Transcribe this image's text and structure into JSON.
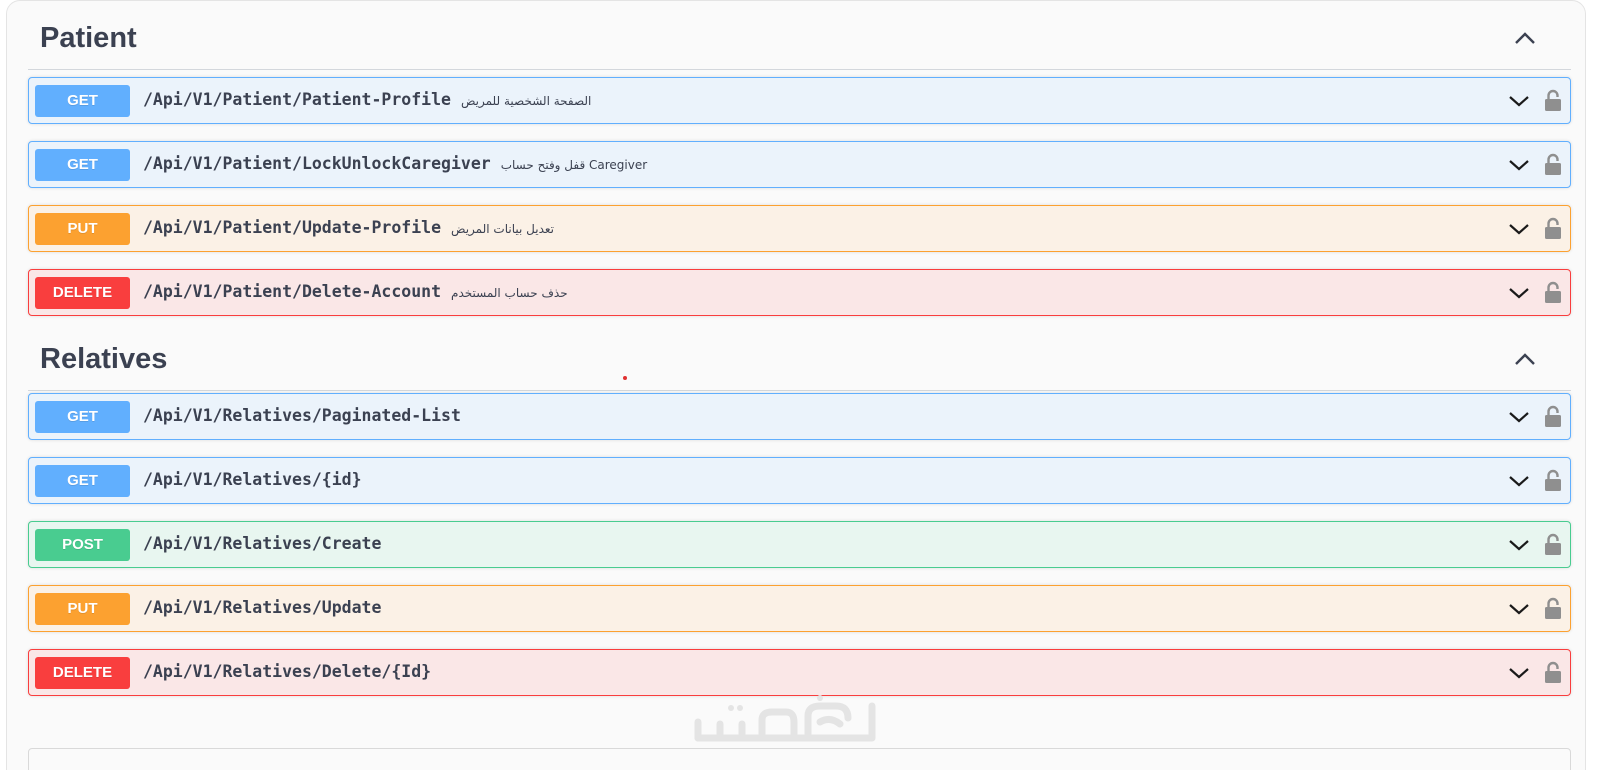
{
  "sections": [
    {
      "title": "Patient",
      "operations": [
        {
          "method": "GET",
          "path": "/Api/V1/Patient/Patient-Profile",
          "description": "الصفحة الشخصية للمريض"
        },
        {
          "method": "GET",
          "path": "/Api/V1/Patient/LockUnlockCaregiver",
          "description": "قفل وفتح حساب Caregiver"
        },
        {
          "method": "PUT",
          "path": "/Api/V1/Patient/Update-Profile",
          "description": "تعديل بيانات المريض"
        },
        {
          "method": "DELETE",
          "path": "/Api/V1/Patient/Delete-Account",
          "description": "حذف حساب المستخدم"
        }
      ]
    },
    {
      "title": "Relatives",
      "operations": [
        {
          "method": "GET",
          "path": "/Api/V1/Relatives/Paginated-List",
          "description": ""
        },
        {
          "method": "GET",
          "path": "/Api/V1/Relatives/{id}",
          "description": ""
        },
        {
          "method": "POST",
          "path": "/Api/V1/Relatives/Create",
          "description": ""
        },
        {
          "method": "PUT",
          "path": "/Api/V1/Relatives/Update",
          "description": ""
        },
        {
          "method": "DELETE",
          "path": "/Api/V1/Relatives/Delete/{Id}",
          "description": ""
        }
      ]
    }
  ],
  "watermark": "خمسات",
  "colors": {
    "get": "#61affe",
    "put": "#fca130",
    "delete": "#f93e3e",
    "post": "#49cc90",
    "text": "#3b4151"
  },
  "icons": {
    "collapse": "chevron-up-icon",
    "expand": "chevron-down-icon",
    "lock": "lock-icon"
  }
}
